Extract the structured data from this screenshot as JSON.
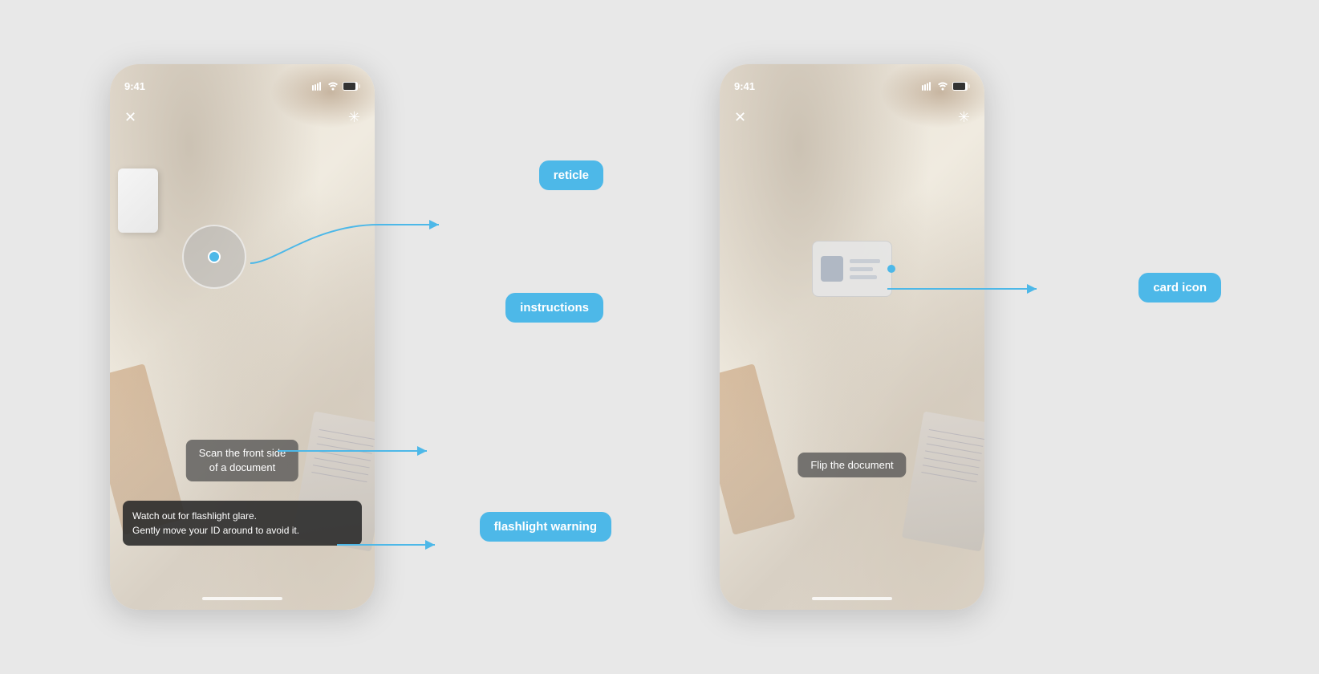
{
  "page": {
    "background_color": "#e8e8e8"
  },
  "phone1": {
    "status_time": "9:41",
    "close_button": "✕",
    "flashlight_button": "✳",
    "reticle_label": "reticle",
    "instructions_label": "instructions",
    "flashlight_warning_label": "flashlight warning",
    "instructions_text_line1": "Scan the front side",
    "instructions_text_line2": "of a document",
    "flashlight_text_line1": "Watch out for flashlight glare.",
    "flashlight_text_line2": "Gently move your ID around to avoid it."
  },
  "phone2": {
    "status_time": "9:41",
    "close_button": "✕",
    "flashlight_button": "✳",
    "card_icon_label": "card icon",
    "flip_document_text": "Flip the document"
  }
}
